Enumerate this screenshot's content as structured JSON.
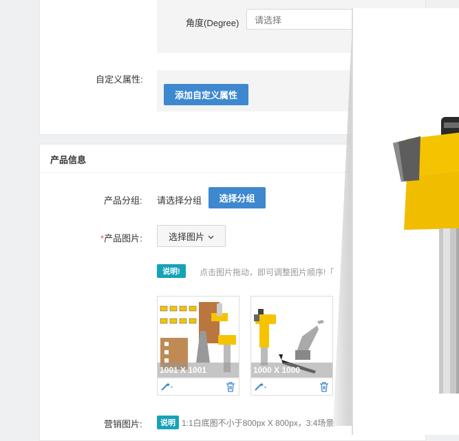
{
  "attributes": {
    "degree_label": "角度(Degree)",
    "degree_placeholder": "请选择",
    "custom_attr_label": "自定义属性:",
    "add_custom_attr_button": "添加自定义属性"
  },
  "product_info": {
    "section_title": "产品信息",
    "group_label": "产品分组:",
    "group_value": "请选择分组",
    "select_group_button": "选择分组",
    "images_required_mark": "*",
    "images_label": "产品图片:",
    "select_images_button": "选择图片",
    "note_badge": "说明!",
    "note_text": "点击图片拖动，即可调整图片顺序!「",
    "images": [
      {
        "size": "1001 X 1001",
        "icon_edit": "magic-wand-icon",
        "icon_delete": "trash-icon"
      },
      {
        "size": "1000 X 1000",
        "icon_edit": "magic-wand-icon",
        "icon_delete": "trash-icon"
      }
    ],
    "marketing_label": "营销图片:",
    "marketing_badge": "说明",
    "marketing_note": "1:1白底图不小于800px X 800px，3:4场景"
  },
  "colors": {
    "primary_button": "#3d88cf",
    "badge": "#17a2b8",
    "required": "#e74c3c",
    "product_yellow": "#f5c400"
  }
}
